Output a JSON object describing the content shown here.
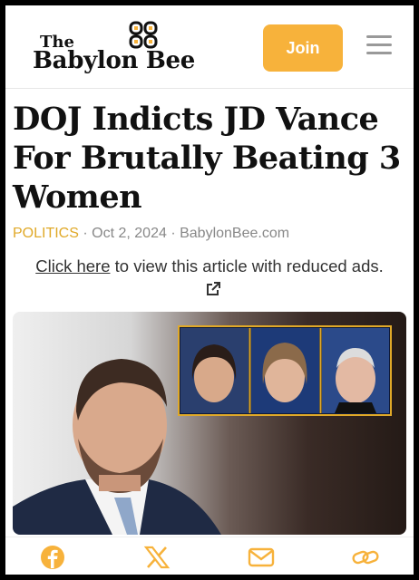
{
  "header": {
    "logo_the": "The",
    "logo_main": "Babylon Bee",
    "join_label": "Join",
    "accent_color": "#f7b23b"
  },
  "article": {
    "headline": "DOJ Indicts JD Vance For Brutally Beating 3 Women",
    "category": "POLITICS",
    "date": "Oct 2, 2024",
    "source": "BabylonBee.com",
    "separator": "·",
    "ad_link_text": "Click here",
    "ad_text": " to view this article with reduced ads."
  },
  "share": {
    "icons": [
      "facebook-icon",
      "x-icon",
      "email-icon",
      "link-icon"
    ],
    "icon_color": "#f7b23b"
  }
}
